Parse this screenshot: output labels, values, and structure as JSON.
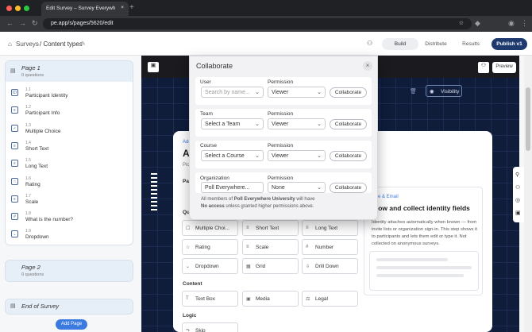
{
  "browser": {
    "tab_title": "Edit Survey – Survey Everywh",
    "url": "pe.app/s/pages/5620/edit"
  },
  "header": {
    "breadcrumb_root": "Surveys",
    "breadcrumb_current": "/ Content types",
    "build": "Build",
    "distribute": "Distribute",
    "results": "Results",
    "publish": "Publish v1"
  },
  "sidebar": {
    "page1": {
      "title": "Page 1",
      "subtitle": "0 questions"
    },
    "questions": [
      {
        "num": "1.1",
        "label": "Participant Identity",
        "icon": "ID"
      },
      {
        "num": "1.2",
        "label": "Participant Info",
        "icon": "≡"
      },
      {
        "num": "1.3",
        "label": "Multiple Choice",
        "icon": "✓"
      },
      {
        "num": "1.4",
        "label": "Short Text",
        "icon": "≡"
      },
      {
        "num": "1.5",
        "label": "Long Text",
        "icon": "≡"
      },
      {
        "num": "1.6",
        "label": "Rating",
        "icon": "☆"
      },
      {
        "num": "1.7",
        "label": "Scale",
        "icon": "≡"
      },
      {
        "num": "1.8",
        "label": "What is the number?",
        "icon": "#"
      },
      {
        "num": "1.9",
        "label": "Dropdown",
        "icon": "⌄"
      }
    ],
    "page2": {
      "title": "Page 2",
      "subtitle": "0 questions"
    },
    "end": {
      "title": "End of Survey"
    },
    "add_page": "Add Page"
  },
  "canvas": {
    "preview": "Preview",
    "visibility": "Visibility"
  },
  "survey": {
    "partial_add": "Add",
    "partial_A": "A",
    "partial_pic": "Pic",
    "partial_pa": "Pa",
    "partial_qu": "Qu",
    "question_types": [
      {
        "label": "Multiple Choi...",
        "icon": "☐"
      },
      {
        "label": "Short Text",
        "icon": "≡"
      },
      {
        "label": "Long Text",
        "icon": "≡"
      },
      {
        "label": "Rating",
        "icon": "☆"
      },
      {
        "label": "Scale",
        "icon": "≡"
      },
      {
        "label": "Number",
        "icon": "#"
      },
      {
        "label": "Dropdown",
        "icon": "⌄"
      },
      {
        "label": "Grid",
        "icon": "▦"
      },
      {
        "label": "Drill Down",
        "icon": "⇩"
      }
    ],
    "content_heading": "Content",
    "content_types": [
      {
        "label": "Text Box",
        "icon": "T"
      },
      {
        "label": "Media",
        "icon": "▣"
      },
      {
        "label": "Legal",
        "icon": "⚖"
      }
    ],
    "logic_heading": "Logic",
    "logic_types": [
      {
        "label": "Skip",
        "icon": "↷"
      }
    ],
    "id_card": {
      "tag": "me & Email",
      "heading": "now and collect identity fields",
      "body": "Identity attaches automatically when known — from invite lists or organization sign-in. This step shows it to participants and lets them edit or type it. Not collected on anonymous surveys."
    }
  },
  "collaborate": {
    "title": "Collaborate",
    "collaborate_label": "Collaborate",
    "permission_label": "Permission",
    "user": {
      "label": "User",
      "placeholder": "Search by name...",
      "permission": "Viewer"
    },
    "team": {
      "label": "Team",
      "value": "Select a Team",
      "permission": "Viewer"
    },
    "course": {
      "label": "Course",
      "value": "Select a Course",
      "permission": "Viewer"
    },
    "organization": {
      "label": "Organization",
      "value": "Poll Everywhere...",
      "permission": "None",
      "note_1": "All members of ",
      "note_org": "Poll Everywhere University",
      "note_2": " will have",
      "note_bold": "No access",
      "note_3": " unless granted higher permissions above."
    }
  },
  "colors": {
    "accent": "#3b7be0",
    "publish": "#1e3a6e",
    "canvas": "#0f1c3a"
  }
}
